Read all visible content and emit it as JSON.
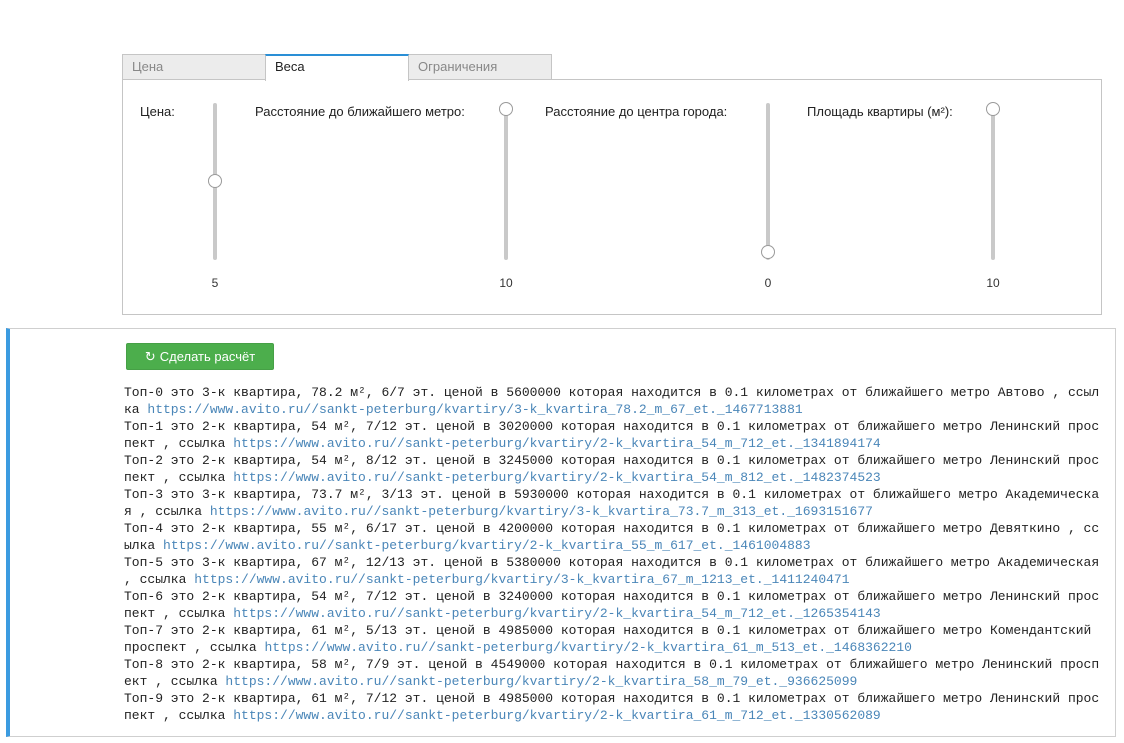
{
  "tabs": [
    {
      "label": "Цена"
    },
    {
      "label": "Веса"
    },
    {
      "label": "Ограничения"
    }
  ],
  "sliders": [
    {
      "label": "Цена:",
      "value": "5",
      "level": 0.5
    },
    {
      "label": "Расстояние до ближайшего метро:",
      "value": "10",
      "level": 1.0
    },
    {
      "label": "Расстояние до центра города:",
      "value": "0",
      "level": 0.0
    },
    {
      "label": "Площадь квартиры (м²):",
      "value": "10",
      "level": 1.0
    }
  ],
  "action_button": {
    "label": "Сделать расчёт",
    "icon": "refresh-icon"
  },
  "results": [
    {
      "text": "Топ-0 это 3-к квартира, 78.2 м², 6/7 эт. ценой в 5600000 которая находится в 0.1 километрах от ближайшего метро Автово , ссылка ",
      "url": "https://www.avito.ru//sankt-peterburg/kvartiry/3-k_kvartira_78.2_m_67_et._1467713881"
    },
    {
      "text": "Топ-1 это 2-к квартира, 54 м², 7/12 эт. ценой в 3020000 которая находится в 0.1 километрах от ближайшего метро Ленинский проспект , ссылка ",
      "url": "https://www.avito.ru//sankt-peterburg/kvartiry/2-k_kvartira_54_m_712_et._1341894174"
    },
    {
      "text": "Топ-2 это 2-к квартира, 54 м², 8/12 эт. ценой в 3245000 которая находится в 0.1 километрах от ближайшего метро Ленинский проспект , ссылка ",
      "url": "https://www.avito.ru//sankt-peterburg/kvartiry/2-k_kvartira_54_m_812_et._1482374523"
    },
    {
      "text": "Топ-3 это 3-к квартира, 73.7 м², 3/13 эт. ценой в 5930000 которая находится в 0.1 километрах от ближайшего метро Академическая , ссылка ",
      "url": "https://www.avito.ru//sankt-peterburg/kvartiry/3-k_kvartira_73.7_m_313_et._1693151677"
    },
    {
      "text": "Топ-4 это 2-к квартира, 55 м², 6/17 эт. ценой в 4200000 которая находится в 0.1 километрах от ближайшего метро Девяткино , ссылка ",
      "url": "https://www.avito.ru//sankt-peterburg/kvartiry/2-k_kvartira_55_m_617_et._1461004883"
    },
    {
      "text": "Топ-5 это 3-к квартира, 67 м², 12/13 эт. ценой в 5380000 которая находится в 0.1 километрах от ближайшего метро Академическая , ссылка ",
      "url": "https://www.avito.ru//sankt-peterburg/kvartiry/3-k_kvartira_67_m_1213_et._1411240471"
    },
    {
      "text": "Топ-6 это 2-к квартира, 54 м², 7/12 эт. ценой в 3240000 которая находится в 0.1 километрах от ближайшего метро Ленинский проспект , ссылка ",
      "url": "https://www.avito.ru//sankt-peterburg/kvartiry/2-k_kvartira_54_m_712_et._1265354143"
    },
    {
      "text": "Топ-7 это 2-к квартира, 61 м², 5/13 эт. ценой в 4985000 которая находится в 0.1 километрах от ближайшего метро Комендантский проспект , ссылка ",
      "url": "https://www.avito.ru//sankt-peterburg/kvartiry/2-k_kvartira_61_m_513_et._1468362210"
    },
    {
      "text": "Топ-8 это 2-к квартира, 58 м², 7/9 эт. ценой в 4549000 которая находится в 0.1 километрах от ближайшего метро Ленинский проспект , ссылка ",
      "url": "https://www.avito.ru//sankt-peterburg/kvartiry/2-k_kvartira_58_m_79_et._936625099"
    },
    {
      "text": "Топ-9 это 2-к квартира, 61 м², 7/12 эт. ценой в 4985000 которая находится в 0.1 километрах от ближайшего метро Ленинский проспект , ссылка ",
      "url": "https://www.avito.ru//sankt-peterburg/kvartiry/2-k_kvartira_61_m_712_et._1330562089"
    }
  ],
  "colors": {
    "accent": "#2a8fd6",
    "button": "#4cae4c",
    "link": "#4a86b8",
    "output_border": "#3b9be0"
  }
}
